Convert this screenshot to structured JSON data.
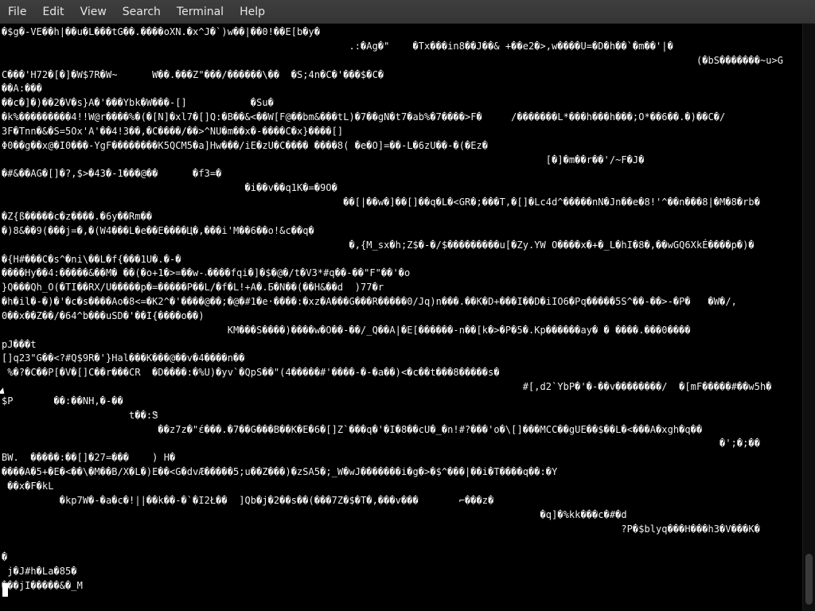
{
  "menubar": {
    "items": [
      "File",
      "Edit",
      "View",
      "Search",
      "Terminal",
      "Help"
    ]
  },
  "terminal": {
    "lines": [
      "�$g�-VE��h|��u�L���tG��.����oXN.�x^J�`)w��|��0!��E[b�y�",
      "                                                            .:�Ag�\"    �Tx���in8��J��& +��e2�>,w����U=�D�h��`�m��'|�",
      "                                                                                                                        (�bS�������~u>G",
      "C���'H72�[�]�W$7R�W~      W��.���Z\"���/������\\��  �S;4n�C�'���$�C�",
      "��A:���",
      "��c�]�)��2�V�s}A�'���Ybk�W���-[]           �Su�",
      "�k%���������4!!W@r����%�(�[N]�xl7�[]Q:�B��&<��W[F@��bm&���tL)�7��gN�t7�ab%�7����>F�     /�������L*���h���h���;O*��6��.�)��C�/",
      "3F�Tnn�&�S=5Ox'A'��4!3��,�C����/��>^NU�m��x�-����C�x}����[]",
      "Φ0��g��x@�I0���-YgF��������K5QCM5�a]Hw���/iE�zU�C���� ����8( �e�O]=��-L�6zU��-�(�Ez�",
      "                                                                                              [�]�m��r��'/~F�J�",
      "�#&��AG�[]�?,$>�43�-1���@��      �f3=�",
      "                                          �i��v��q1K�=�9O�",
      "                                                           ��[|��w�]��[]��q�L�<GR�;���T,�[]�Lc4d^�����nN�Jn��e�8!'^��n���8|�M�8�rb�",
      "�Z{ß�����c�z����.�6y��Rm��",
      "�)8&��9(���j=�,�(W4���L�e��E����Ц�,���i'M��6��o!&c��q�",
      "                                                            �,{M_sx�h;Z$�-�/$���������u[�Zy.YW O����x�+�_L�hI�8�,��wGQ6XkÉ����p�)�",
      "�{H#���C�s^�ni\\��L�f{���1U�.�-�",
      "����Hy��4:�����&��M� ��(�o+1�>=��w-˔����fqi�]�$�@�/t�V3*#q��-��\"F\"��'�o",
      "}Q���Qh_O(�TI��RX/U�����p�=�����P��L/�f�L!+A�.Б�N��(��H&��d  )77�r",
      "�h�il�-�)�'�c�s����Ao�8<=�K2^�'����@��;�@�#1�e·����:�xz�A���G���R�����0/Jq)n���.��K�D+���I��D�iIO6�Pq�����5S^��-��>-�P�   �W�/,",
      "0��x��Z��/�64^b���uSD�'��I{����o��)",
      "                                       KM���S����)����w�O��-��/_Q��A|�E[������-n��[k�>�P�5�.Kp������ay� � ����.���0����",
      "pJ���t",
      "[]q23\"G��<?#Q$9R�'}Hal���K���@��v�4����n��",
      " %�?�C��P[�V�[]C��r���CR  �D����:�%U)�yv`�QpS��\"(4�����#'����-�-�a��)<�c��t���8�����s�",
      "                                                                                          #[,d2`YbP�'�-��v��������/  �[mF�����#��w5h�",
      "$P       ��:��NH,�-��",
      "                      t��:Ꮥ",
      "                           ��z7z�\"έ���.�7��G���B��K�E�6�[]Z`���q�'�I�8��cU�_�n!#?���'o�\\[]���MCC��gUE��$��L�<���A�xgh�q��",
      "                                                                                                                            �';�;��",
      "BW.  �����:��[]�27=���    ) H�",
      "����A�5+�E�<��\\�M��B/X�L�)E��<G�dvÆ�����5;u��Z���)�zSA5�;_W�wJ�������i�g�>�$^���|��i�T����q��:�Y",
      " ��x�F�kL",
      "          �kp7W�-�a�c�!||��k��-�`�I2Ł��  ]Qb�j�2��s��(���7Z�$�T�,���v���       ⌐���z�",
      "                                                                                             �q]�%kk���c�#�d",
      "                                                                                                           ?P�$blyq���H���h3�V���K�",
      "",
      "�",
      " j�J#h�La�85�",
      "���jI�����&�_M"
    ]
  }
}
